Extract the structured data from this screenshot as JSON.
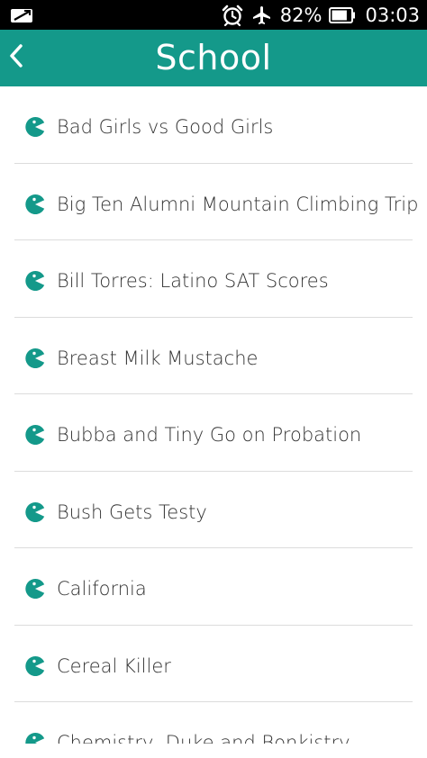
{
  "status_bar": {
    "left_icon": "screen-mirror-icon",
    "alarm_icon": "alarm-clock-icon",
    "airplane_icon": "airplane-icon",
    "battery_percent": "82%",
    "battery_level": 0.82,
    "battery_icon": "battery-icon",
    "time": "03:03"
  },
  "app_bar": {
    "back_icon": "chevron-left-icon",
    "title": "School",
    "color": "#14998a"
  },
  "list": {
    "item_icon": "pacman-icon",
    "icon_color": "#14998a",
    "items": [
      "Bad Girls vs Good Girls",
      "Big Ten Alumni Mountain Climbing Trip",
      "Bill Torres: Latino SAT Scores",
      "Breast Milk Mustache",
      "Bubba and Tiny Go on Probation",
      "Bush Gets Testy",
      "California",
      "Cereal Killer",
      "Chemistry, Duke and Bonkistry"
    ]
  }
}
